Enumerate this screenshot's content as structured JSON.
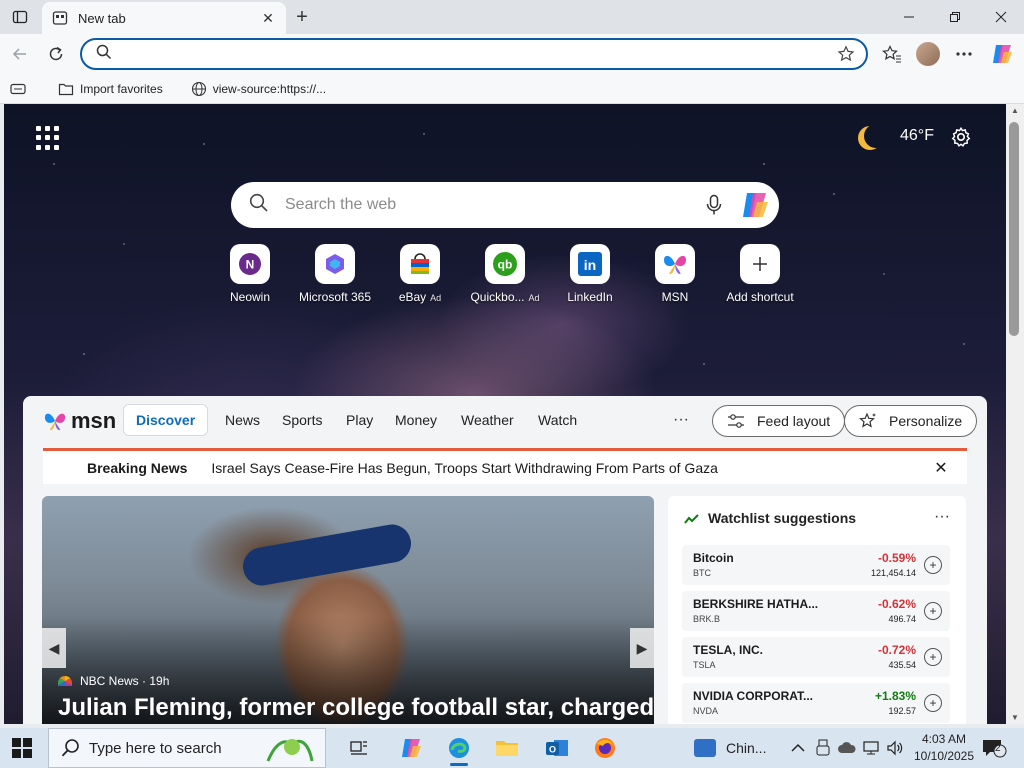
{
  "browser": {
    "tab_title": "New tab",
    "address_value": "",
    "favorites": [
      {
        "label": "Import favorites",
        "icon": "folder-icon"
      },
      {
        "label": "view-source:https://...",
        "icon": "globe-icon"
      }
    ]
  },
  "ntp": {
    "weather_temp": "46°F",
    "search_placeholder": "Search the web",
    "shortcuts": [
      {
        "label": "Neowin",
        "ad": ""
      },
      {
        "label": "Microsoft 365",
        "ad": ""
      },
      {
        "label": "eBay",
        "ad": "Ad"
      },
      {
        "label": "Quickbo...",
        "ad": "Ad"
      },
      {
        "label": "LinkedIn",
        "ad": ""
      },
      {
        "label": "MSN",
        "ad": ""
      },
      {
        "label": "Add shortcut",
        "ad": ""
      }
    ]
  },
  "feed": {
    "logo": "msn",
    "nav": [
      "Discover",
      "News",
      "Sports",
      "Play",
      "Money",
      "Weather",
      "Watch"
    ],
    "more": "···",
    "feed_layout": "Feed layout",
    "personalize": "Personalize",
    "breaking_title": "Breaking News",
    "breaking_headline": "Israel Says Cease-Fire Has Begun, Troops Start Withdrawing From Parts of Gaza",
    "hero": {
      "source": "NBC News · 19h",
      "headline": "Julian Fleming, former college football star, charged"
    },
    "watchlist": {
      "title": "Watchlist suggestions",
      "more": "···",
      "items": [
        {
          "name": "Bitcoin",
          "ticker": "BTC",
          "change": "-0.59%",
          "price": "121,454.14",
          "color": "#d13438"
        },
        {
          "name": "BERKSHIRE HATHA...",
          "ticker": "BRK.B",
          "change": "-0.62%",
          "price": "496.74",
          "color": "#d13438"
        },
        {
          "name": "TESLA, INC.",
          "ticker": "TSLA",
          "change": "-0.72%",
          "price": "435.54",
          "color": "#d13438"
        },
        {
          "name": "NVIDIA CORPORAT...",
          "ticker": "NVDA",
          "change": "+1.83%",
          "price": "192.57",
          "color": "#107c10"
        }
      ]
    }
  },
  "taskbar": {
    "search_placeholder": "Type here to search",
    "tray_app_label": "Chin...",
    "time": "4:03 AM",
    "date": "10/10/2025",
    "notification_count": "2"
  },
  "colors": {
    "accent": "#0f6cbd",
    "omnibox_border": "#0c59a4",
    "breaking_bar": "#e35b3c"
  }
}
